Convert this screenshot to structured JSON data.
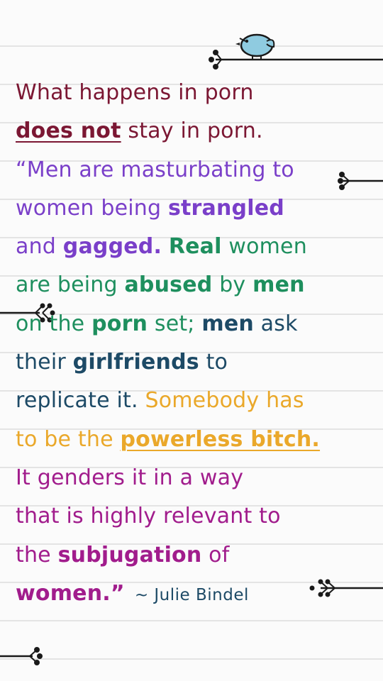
{
  "quote": {
    "line1": "What happens in porn",
    "line2_emph": "does not",
    "line2_rest": " stay in porn.",
    "line3": "“Men are masturbating to",
    "line4_a": "women being ",
    "line4_emph": "strangled",
    "line5_a": "and ",
    "line5_emph1": "gagged.",
    "line5_b": " ",
    "line5_emph2": "Real",
    "line5_c": " women",
    "line6_a": "are being ",
    "line6_emph1": "abused",
    "line6_b": " by ",
    "line6_emph2": "men",
    "line7_a": "on the ",
    "line7_emph1": "porn",
    "line7_b": " set; ",
    "line7_emph2": "men",
    "line7_c": " ask",
    "line8_a": "their ",
    "line8_emph": "girlfriends",
    "line8_b": " to",
    "line9_a": "replicate it.",
    "line9_b": " Somebody has",
    "line10_a": "to be the ",
    "line10_emph": "powerless bitch.",
    "line11": "It genders it in a way",
    "line12": "that is highly relevant to",
    "line13_a": "the ",
    "line13_emph": "subjugation",
    "line13_b": " of",
    "line14_emph": "women.”",
    "author": "~ Julie Bindel"
  },
  "colors": {
    "maroon": "#7b1733",
    "purple": "#7a3fc9",
    "green": "#1e8f5e",
    "navy": "#1d4a66",
    "gold": "#eaa82a",
    "magenta": "#a11c8c",
    "bird": "#8fcbe0",
    "branch": "#1a1a1a"
  },
  "icons": {
    "bird": "bird-icon",
    "branch": "branch-icon"
  }
}
